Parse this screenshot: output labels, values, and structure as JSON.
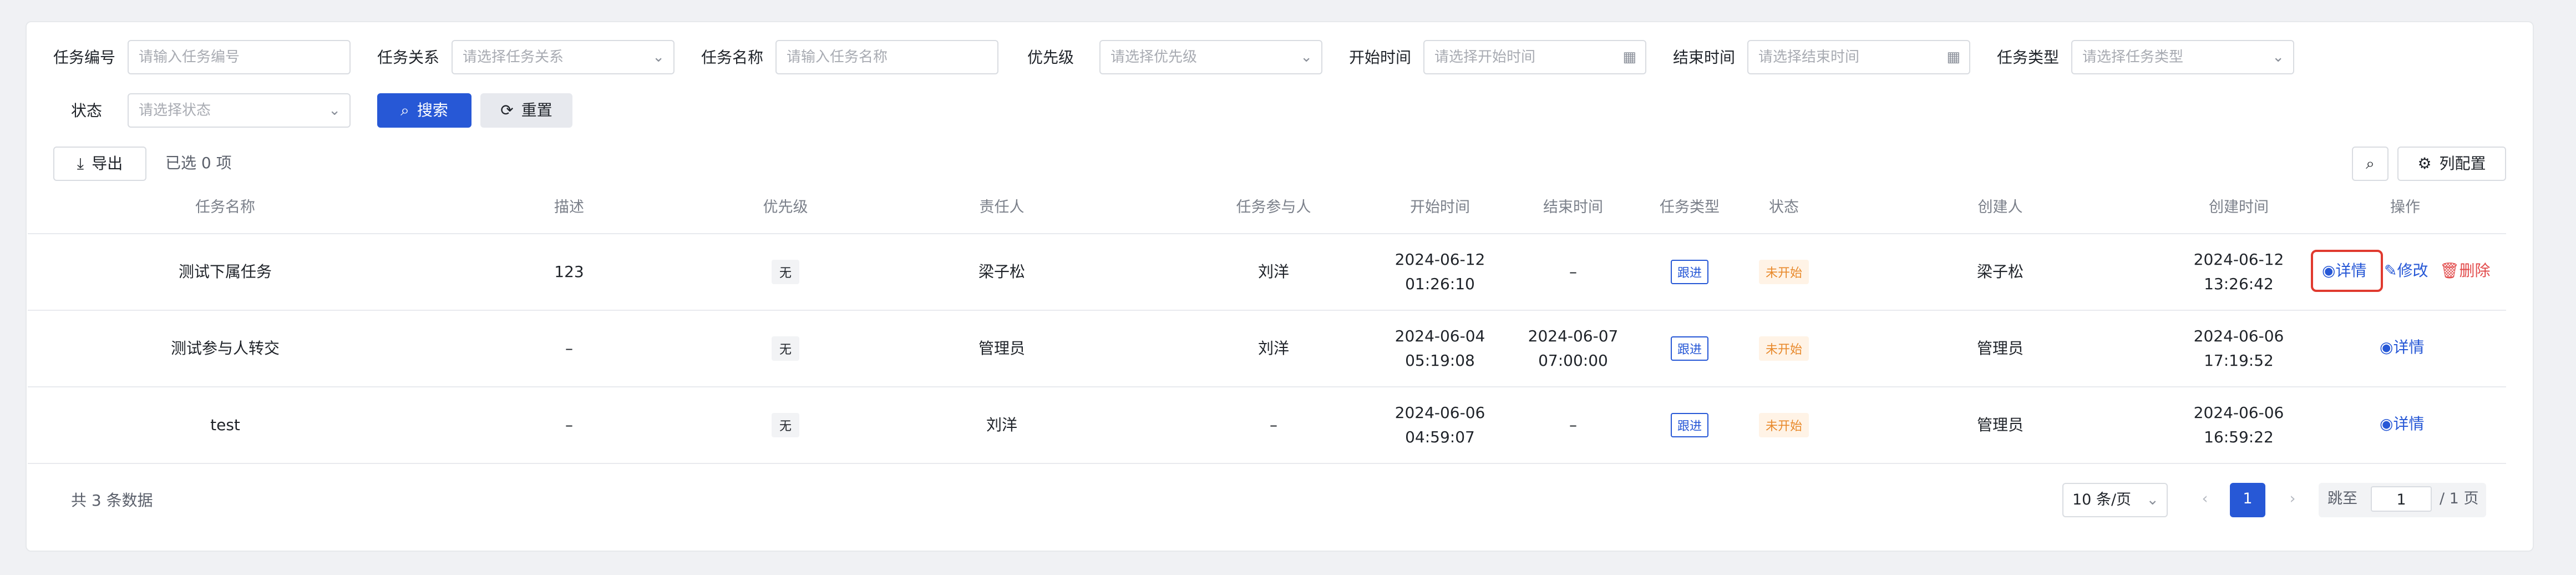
{
  "filters": {
    "task_no": {
      "label": "任务编号",
      "placeholder": "请输入任务编号"
    },
    "task_relation": {
      "label": "任务关系",
      "placeholder": "请选择任务关系"
    },
    "task_name": {
      "label": "任务名称",
      "placeholder": "请输入任务名称"
    },
    "priority": {
      "label": "优先级",
      "placeholder": "请选择优先级"
    },
    "start_time": {
      "label": "开始时间",
      "placeholder": "请选择开始时间"
    },
    "end_time": {
      "label": "结束时间",
      "placeholder": "请选择结束时间"
    },
    "task_type": {
      "label": "任务类型",
      "placeholder": "请选择任务类型"
    },
    "status": {
      "label": "状态",
      "placeholder": "请选择状态"
    },
    "search_label": "搜索",
    "reset_label": "重置"
  },
  "toolbar": {
    "export_label": "导出",
    "selected_text": "已选 0 项",
    "column_config_label": "列配置"
  },
  "table": {
    "headers": [
      "任务名称",
      "描述",
      "优先级",
      "责任人",
      "任务参与人",
      "开始时间",
      "结束时间",
      "任务类型",
      "状态",
      "创建人",
      "创建时间",
      "操作"
    ],
    "rows": [
      {
        "name": "测试下属任务",
        "desc": "123",
        "priority": "无",
        "owner": "梁子松",
        "participant": "刘洋",
        "start_date": "2024-06-12",
        "start_time": "01:26:10",
        "end_date": "–",
        "end_time": "",
        "type": "跟进",
        "status": "未开始",
        "creator": "梁子松",
        "created_date": "2024-06-12",
        "created_time": "13:26:42",
        "actions": {
          "detail": "详情",
          "edit": "修改",
          "delete": "删除"
        }
      },
      {
        "name": "测试参与人转交",
        "desc": "–",
        "priority": "无",
        "owner": "管理员",
        "participant": "刘洋",
        "start_date": "2024-06-04",
        "start_time": "05:19:08",
        "end_date": "2024-06-07",
        "end_time": "07:00:00",
        "type": "跟进",
        "status": "未开始",
        "creator": "管理员",
        "created_date": "2024-06-06",
        "created_time": "17:19:52",
        "actions": {
          "detail": "详情"
        }
      },
      {
        "name": "test",
        "desc": "–",
        "priority": "无",
        "owner": "刘洋",
        "participant": "–",
        "start_date": "2024-06-06",
        "start_time": "04:59:07",
        "end_date": "–",
        "end_time": "",
        "type": "跟进",
        "status": "未开始",
        "creator": "管理员",
        "created_date": "2024-06-06",
        "created_time": "16:59:22",
        "actions": {
          "detail": "详情"
        }
      }
    ]
  },
  "pagination": {
    "total_text": "共 3 条数据",
    "page_size": "10 条/页",
    "current_page": "1",
    "jump_label": "跳至",
    "jump_value": "1",
    "total_pages": "/ 1 页"
  },
  "colors": {
    "primary": "#2758d6",
    "danger": "#e24c4c",
    "warning": "#e8892b",
    "highlight": "#e03a2f"
  }
}
